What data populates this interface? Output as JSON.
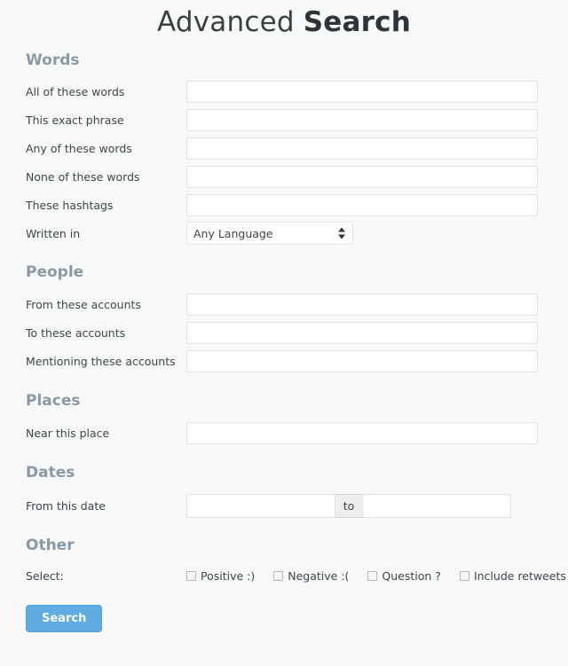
{
  "title": {
    "light": "Advanced ",
    "strong": "Search"
  },
  "sections": {
    "words": {
      "heading": "Words",
      "rows": [
        {
          "label": "All of these words",
          "value": "",
          "placeholder": ""
        },
        {
          "label": "This exact phrase",
          "value": "",
          "placeholder": ""
        },
        {
          "label": "Any of these words",
          "value": "",
          "placeholder": ""
        },
        {
          "label": "None of these words",
          "value": "",
          "placeholder": ""
        },
        {
          "label": "These hashtags",
          "value": "",
          "placeholder": ""
        }
      ],
      "language_row": {
        "label": "Written in",
        "selected": "Any Language",
        "arrow_icon": "updown-arrow-icon"
      }
    },
    "people": {
      "heading": "People",
      "rows": [
        {
          "label": "From these accounts",
          "value": "",
          "placeholder": ""
        },
        {
          "label": "To these accounts",
          "value": "",
          "placeholder": ""
        },
        {
          "label": "Mentioning these accounts",
          "value": "",
          "placeholder": ""
        }
      ]
    },
    "places": {
      "heading": "Places",
      "rows": [
        {
          "label": "Near this place",
          "value": "",
          "placeholder": ""
        }
      ]
    },
    "dates": {
      "heading": "Dates",
      "row": {
        "label": "From this date",
        "from_value": "",
        "from_placeholder": "",
        "separator": "to",
        "to_value": "",
        "to_placeholder": ""
      }
    },
    "other": {
      "heading": "Other",
      "select_label": "Select:",
      "checkboxes": [
        {
          "label": "Positive :)",
          "checked": false
        },
        {
          "label": "Negative :(",
          "checked": false
        },
        {
          "label": "Question ?",
          "checked": false
        },
        {
          "label": "Include retweets",
          "checked": false
        }
      ]
    }
  },
  "submit": {
    "label": "Search"
  },
  "colors": {
    "page_background": "#f7f8f8",
    "heading": "#8b99a7",
    "label": "#3f454c",
    "input_border": "#dde3ea",
    "button_background": "#5eace3",
    "button_text": "#ffffff",
    "addon_background": "#eeeeee"
  }
}
